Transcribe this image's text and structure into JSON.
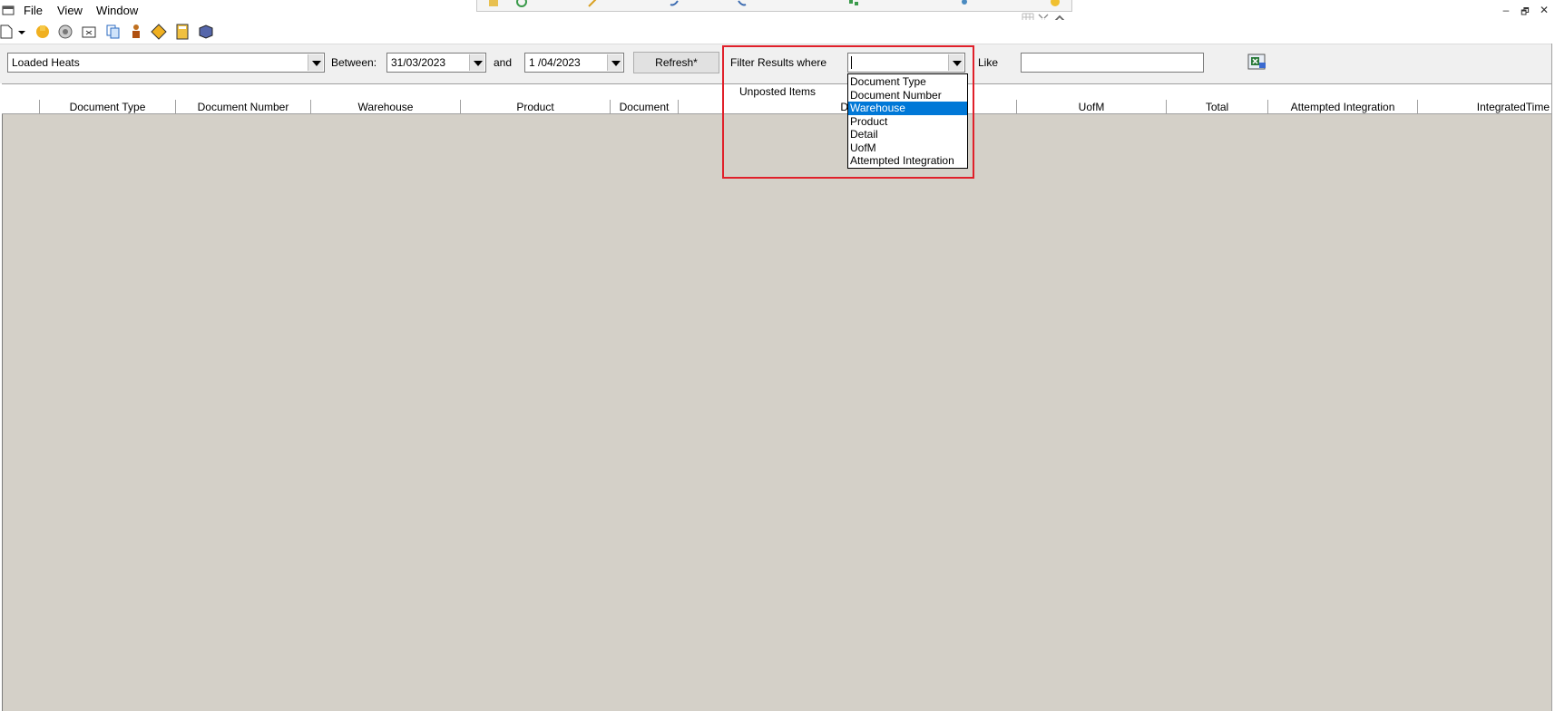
{
  "menu": {
    "items": [
      "File",
      "View",
      "Window"
    ]
  },
  "window_controls": {
    "minimize": "–",
    "restore": "🗗",
    "close": "✕"
  },
  "toolbar": {
    "icons": [
      "new-icon",
      "dropdown-arrow-icon",
      "hand-icon",
      "disc-icon",
      "folder-icon",
      "copy-icon",
      "person-icon",
      "warning-sign-icon",
      "calculator-icon",
      "box-icon"
    ]
  },
  "form": {
    "report_select": "Loaded Heats",
    "between_label": "Between:",
    "date_from": "31/03/2023",
    "and_label": "and",
    "date_to": "1 /04/2023",
    "refresh_label": "Refresh*",
    "filter_label": "Filter Results where",
    "filter_value": "",
    "like_label": "Like",
    "like_value": ""
  },
  "filter_options": [
    "Document Type",
    "Document Number",
    "Warehouse",
    "Product",
    "Detail",
    "UofM",
    "Attempted Integration"
  ],
  "filter_selected_index": 2,
  "grid": {
    "group_label": "Unposted Items",
    "columns": [
      "",
      "Document Type",
      "Document Number",
      "Warehouse",
      "Product",
      "Document",
      "De",
      "UofM",
      "Total",
      "Attempted Integration",
      "IntegratedTime"
    ]
  },
  "colors": {
    "highlight": "#0078d7",
    "callout": "#e0202a",
    "grid_bg": "#d4d0c8"
  }
}
